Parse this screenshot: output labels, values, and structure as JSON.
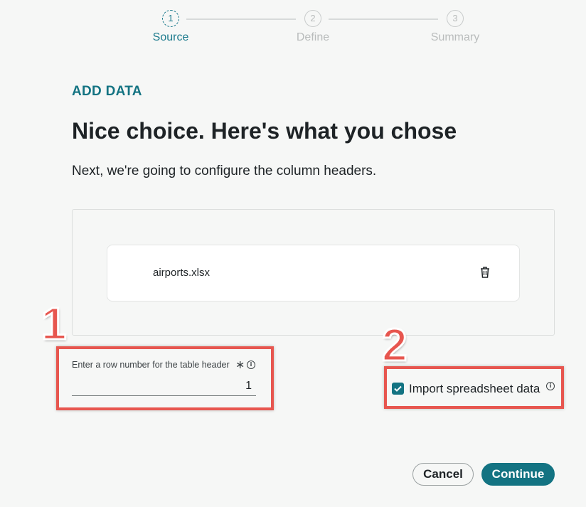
{
  "stepper": {
    "steps": [
      {
        "number": "1",
        "label": "Source",
        "state": "active"
      },
      {
        "number": "2",
        "label": "Define",
        "state": "inactive"
      },
      {
        "number": "3",
        "label": "Summary",
        "state": "inactive"
      }
    ]
  },
  "header": {
    "eyebrow": "ADD DATA",
    "title": "Nice choice. Here's what you chose",
    "subtitle": "Next, we're going to configure the column headers."
  },
  "file": {
    "name": "airports.xlsx",
    "delete_icon": "trash-icon"
  },
  "row_field": {
    "label": "Enter a row number for the table header",
    "required_mark": "∗",
    "value": "1",
    "info_icon": "info-icon"
  },
  "import_option": {
    "label": "Import spreadsheet data",
    "checked": true,
    "info_icon": "info-icon"
  },
  "annotations": {
    "callout_1": "1",
    "callout_2": "2"
  },
  "actions": {
    "cancel_label": "Cancel",
    "continue_label": "Continue"
  },
  "colors": {
    "accent": "#137382",
    "highlight": "#e7564f",
    "background": "#f6f7f6"
  }
}
